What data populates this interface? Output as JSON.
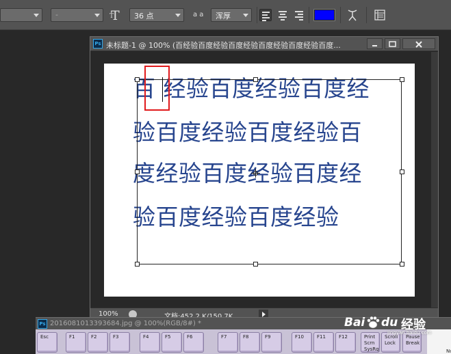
{
  "options_bar": {
    "font_family_value": "",
    "font_style_value": "-",
    "font_size_value": "36 点",
    "antialias_icon_text": "a a",
    "antialias_value": "浑厚",
    "text_color": "#0000ff"
  },
  "document": {
    "title": "未标题-1 @ 100% (百经验百度经验百度经验百度经验百度经验百度...",
    "ps_badge": "Ps",
    "text_lines": [
      "百 经验百度经验百度经",
      "验百度经验百度经验百",
      "度经验百度经验百度经",
      "验百度经验百度经验"
    ],
    "text_color": "#27458e",
    "zoom": "100%",
    "doc_info": "文档:452.2 K/150.7K"
  },
  "second_document": {
    "ps_badge": "Ps",
    "title": "2016081013393684.jpg @ 100%(RGB/8#) *"
  },
  "keyboard": {
    "keys": [
      "Esc",
      "F1",
      "F2",
      "F3",
      "F4",
      "F5",
      "F6",
      "F7",
      "F8",
      "F9",
      "F10",
      "F11",
      "F12",
      "Print Scrn SysRq",
      "Scroll Lock",
      "Pause Break"
    ],
    "partial_key": "Nu"
  },
  "watermark": {
    "brand": "Bai",
    "brand2": "du",
    "suffix": "经验",
    "url": "jingyan.baidu.com"
  }
}
